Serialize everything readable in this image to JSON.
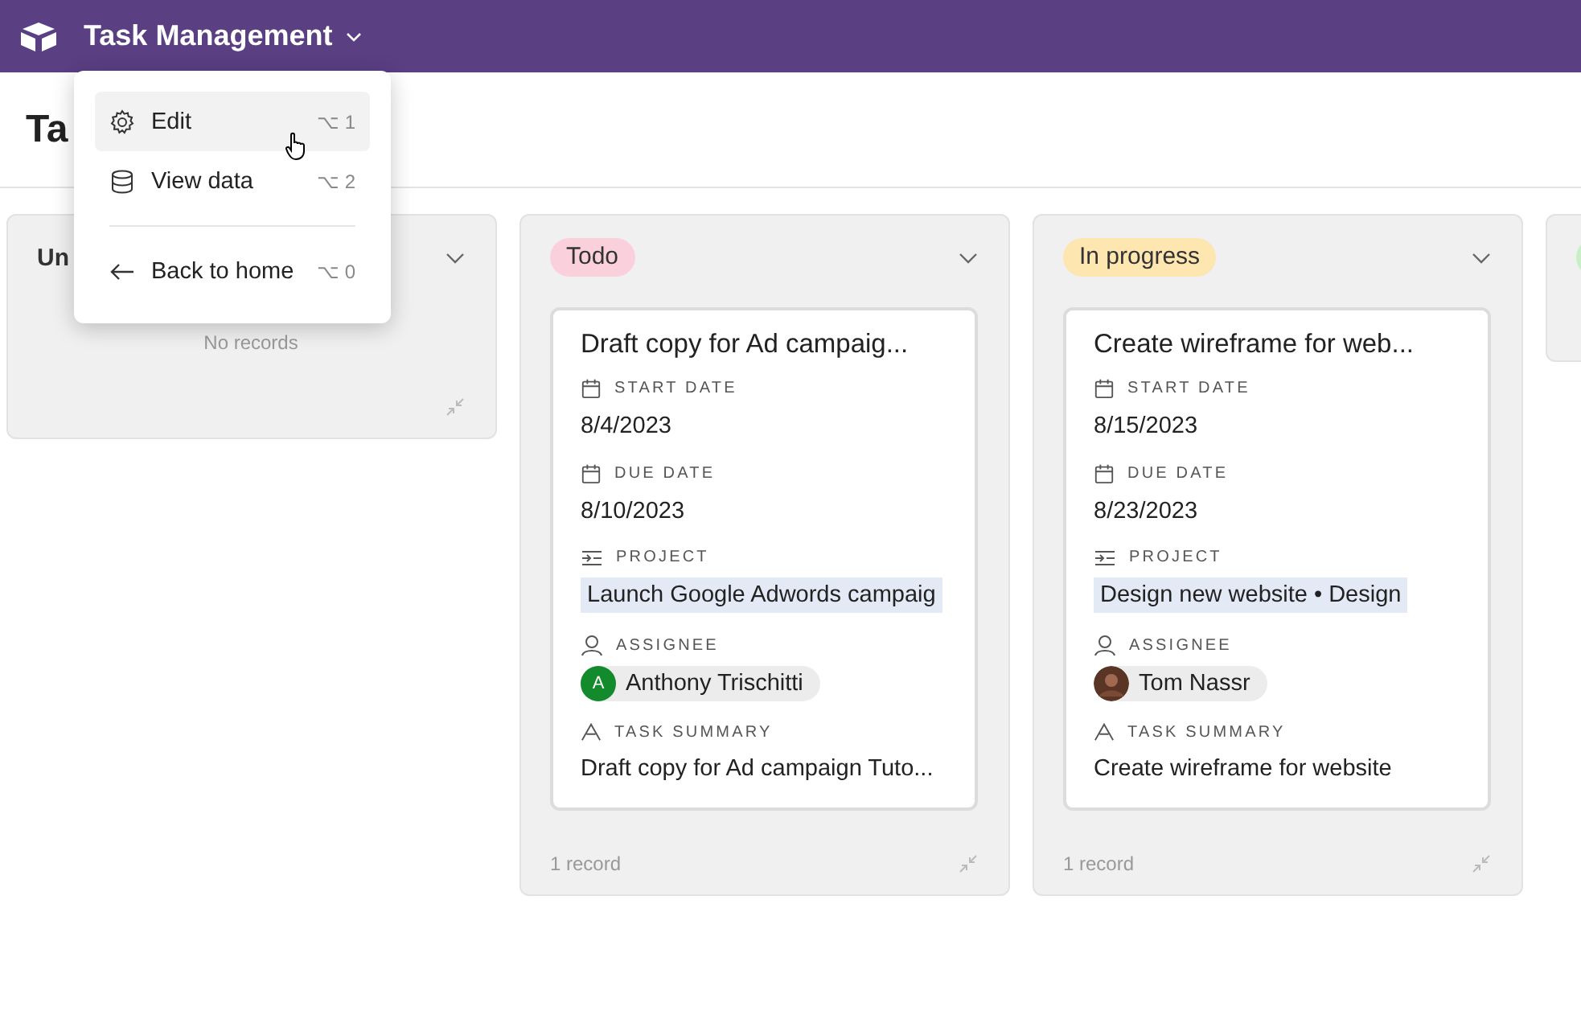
{
  "app_bar": {
    "title": "Task Management"
  },
  "page": {
    "heading": "Ta"
  },
  "menu": {
    "items": [
      {
        "kind": "settings",
        "label": "Edit",
        "shortcut": "⌥ 1",
        "selected": true
      },
      {
        "kind": "database",
        "label": "View data",
        "shortcut": "⌥ 2",
        "selected": false
      },
      {
        "kind": "back",
        "label": "Back to home",
        "shortcut": "⌥ 0",
        "selected": false
      }
    ]
  },
  "columns": [
    {
      "kind": "plain",
      "tag": "Un",
      "empty_text": "No records"
    },
    {
      "kind": "pill",
      "tag": "Todo",
      "color": "#fbd0dd",
      "footer": "1 record",
      "cards": [
        {
          "title": "Draft copy for Ad campaig...",
          "start_label": "START DATE",
          "start": "8/4/2023",
          "due_label": "DUE DATE",
          "due": "8/10/2023",
          "project_label": "PROJECT",
          "project": "Launch Google Adwords campaig",
          "assignee_label": "ASSIGNEE",
          "assignee": {
            "name": "Anthony Trischitti",
            "kind": "initial",
            "initial": "A"
          },
          "summary_label": "TASK SUMMARY",
          "summary": "Draft copy for Ad campaign Tuto..."
        }
      ]
    },
    {
      "kind": "pill",
      "tag": "In progress",
      "color": "#fde6b0",
      "footer": "1 record",
      "cards": [
        {
          "title": "Create wireframe for web...",
          "start_label": "START DATE",
          "start": "8/15/2023",
          "due_label": "DUE DATE",
          "due": "8/23/2023",
          "project_label": "PROJECT",
          "project": "Design new website • Design",
          "assignee_label": "ASSIGNEE",
          "assignee": {
            "name": "Tom Nassr",
            "kind": "photo"
          },
          "summary_label": "TASK SUMMARY",
          "summary": "Create wireframe for website"
        }
      ]
    },
    {
      "kind": "pill",
      "color": "#c8f0c8"
    }
  ]
}
